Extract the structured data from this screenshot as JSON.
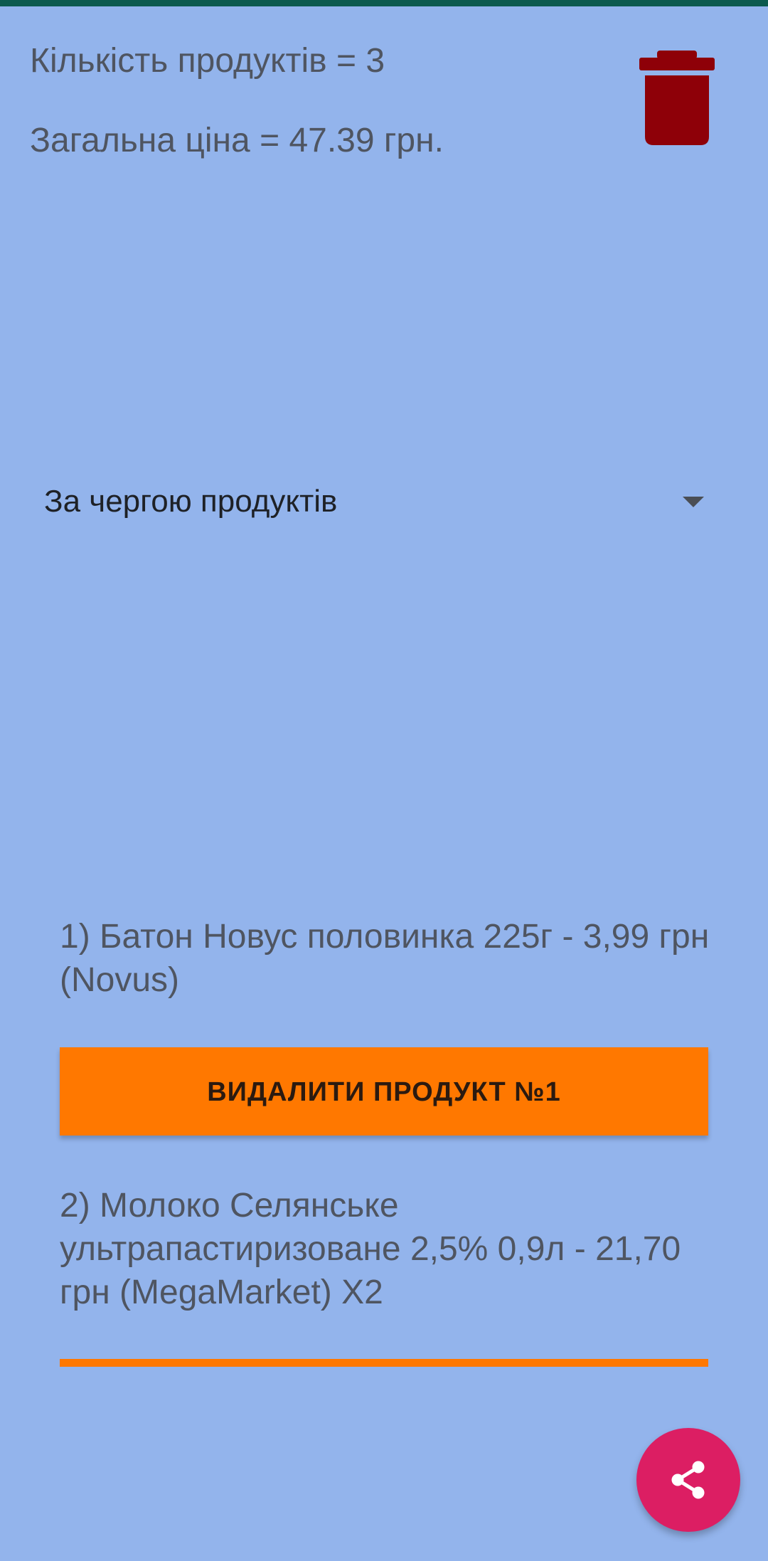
{
  "summary": {
    "count_text": "Кількість продуктів = 3",
    "total_text": "Загальна ціна = 47.39 грн."
  },
  "sort": {
    "selected_label": "За чергою продуктів"
  },
  "products": [
    {
      "text": "1) Батон Новус половинка 225г - 3,99 грн (Novus)",
      "delete_label": "ВИДАЛИТИ ПРОДУКТ №1"
    },
    {
      "text": "2) Молоко Селянське ультрапастиризоване 2,5% 0,9л - 21,70 грн (MegaMarket) X2"
    }
  ],
  "icons": {
    "trash": "trash-icon",
    "dropdown": "dropdown-arrow-icon",
    "share": "share-icon"
  },
  "colors": {
    "background": "#93B4EC",
    "status_strip": "#0C5A4E",
    "trash": "#8E0008",
    "accent_button": "#FF7800",
    "fab": "#DC1E63",
    "text": "#4F5561"
  }
}
